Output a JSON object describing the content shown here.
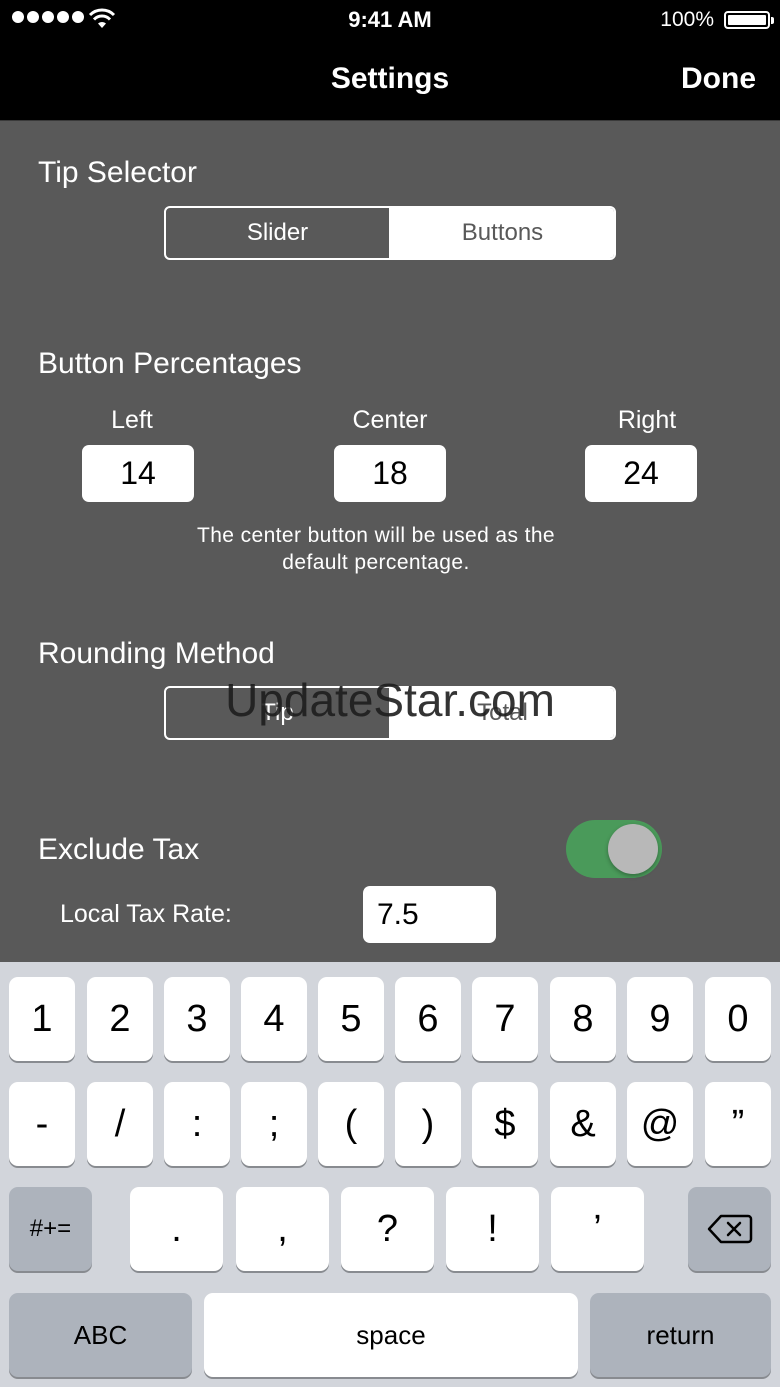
{
  "status_bar": {
    "time": "9:41 AM",
    "battery": "100%",
    "signal_icon": "signal-dots-icon",
    "wifi_icon": "wifi-icon",
    "battery_icon": "battery-icon"
  },
  "nav": {
    "title": "Settings",
    "done": "Done"
  },
  "tip_selector": {
    "title": "Tip Selector",
    "options": [
      "Slider",
      "Buttons"
    ],
    "selected": "Buttons"
  },
  "button_percentages": {
    "title": "Button Percentages",
    "left_label": "Left",
    "left_value": "14",
    "center_label": "Center",
    "center_value": "18",
    "right_label": "Right",
    "right_value": "24",
    "hint_line1": "The center button will be used as the",
    "hint_line2": "default percentage."
  },
  "rounding_method": {
    "title": "Rounding Method",
    "options": [
      "Tip",
      "Total"
    ],
    "selected": "Total"
  },
  "watermark": "UpdateStar.com",
  "exclude_tax": {
    "title": "Exclude Tax",
    "enabled": true,
    "local_tax_label": "Local Tax Rate:",
    "local_tax_value": "7.5"
  },
  "colors": {
    "background": "#595959",
    "toggle_on": "#4a9a5a",
    "keyboard_bg": "#d2d5db"
  },
  "keyboard": {
    "row1": [
      "1",
      "2",
      "3",
      "4",
      "5",
      "6",
      "7",
      "8",
      "9",
      "0"
    ],
    "row2": [
      "-",
      "/",
      ":",
      ";",
      "(",
      ")",
      "$",
      "&",
      "@",
      "”"
    ],
    "symbols_key": "#+=",
    "row3": [
      ".",
      ",",
      "?",
      "!",
      "’"
    ],
    "delete_icon": "backspace-icon",
    "abc_key": "ABC",
    "space_key": "space",
    "return_key": "return"
  }
}
